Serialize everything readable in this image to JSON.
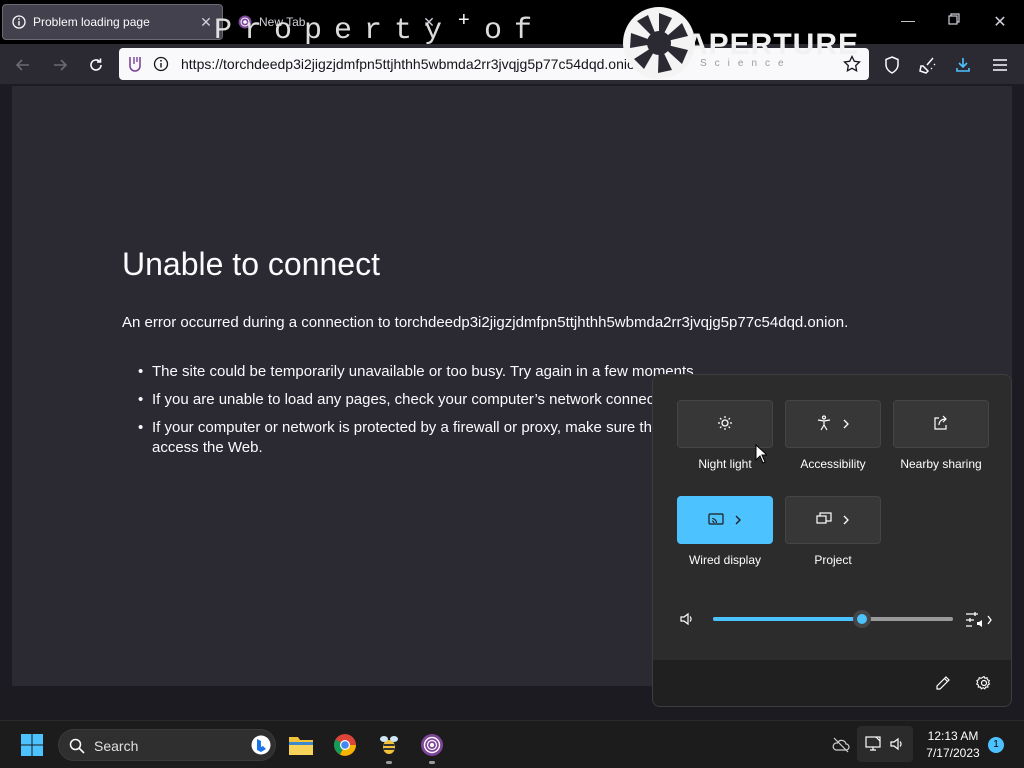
{
  "browser": {
    "tabs": [
      {
        "label": "Problem loading page",
        "active": true
      },
      {
        "label": "New Tab",
        "active": false
      }
    ],
    "url": "https://torchdeedp3i2jigzjdmfpn5ttjhthh5wbmda2rr3jvqjg5p77c54dqd.onion"
  },
  "watermark": {
    "text": "Property of",
    "brand": "APERTURE",
    "sub": "Science"
  },
  "error_page": {
    "title": "Unable to connect",
    "description": "An error occurred during a connection to torchdeedp3i2jigzjdmfpn5ttjhthh5wbmda2rr3jvqjg5p77c54dqd.onion.",
    "bullets": [
      "The site could be temporarily unavailable or too busy. Try again in a few moments.",
      "If you are unable to load any pages, check your computer’s network connection.",
      "If your computer or network is protected by a firewall or proxy, make sure that Tor Browser is permitted to access the Web."
    ]
  },
  "quick_settings": {
    "tiles": [
      {
        "label": "Night light",
        "icon": "brightness-icon",
        "active": false
      },
      {
        "label": "Accessibility",
        "icon": "accessibility-icon",
        "active": false
      },
      {
        "label": "Nearby sharing",
        "icon": "share-icon",
        "active": false
      },
      {
        "label": "Wired display",
        "icon": "cast-icon",
        "active": true
      },
      {
        "label": "Project",
        "icon": "project-icon",
        "active": false
      }
    ],
    "volume_level": 0.62
  },
  "taskbar": {
    "search_label": "Search",
    "clock_time": "12:13 AM",
    "clock_date": "7/17/2023",
    "notification_count": "1"
  },
  "colors": {
    "accent": "#4cc2ff",
    "page_bg": "#2b2a33",
    "tor_purple": "#7d4698"
  }
}
